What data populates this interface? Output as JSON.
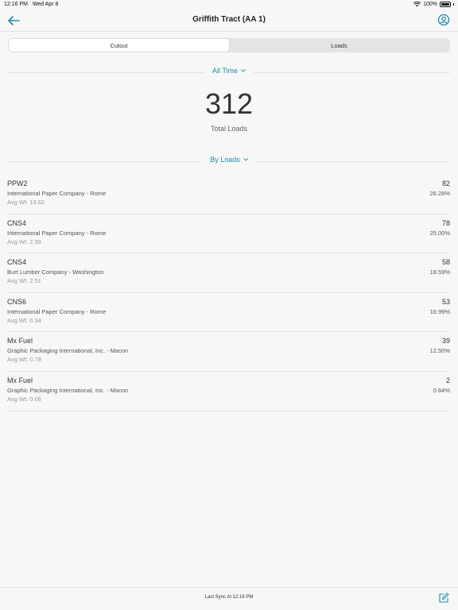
{
  "status_bar": {
    "time": "12:16 PM",
    "date": "Wed Apr 8",
    "battery": "100%",
    "icons": [
      "wifi-icon",
      "battery-icon"
    ]
  },
  "header": {
    "title": "Griffith Tract (AA 1)",
    "back_icon": "arrow-left-icon",
    "profile_icon": "user-circle-icon"
  },
  "tabs": [
    {
      "label": "Cutout",
      "active": true
    },
    {
      "label": "Loads",
      "active": false
    }
  ],
  "time_filter": {
    "label": "All Time",
    "icon": "chevron-down-icon"
  },
  "summary": {
    "value": "312",
    "label": "Total Loads"
  },
  "sort_filter": {
    "label": "By Loads",
    "icon": "chevron-down-icon"
  },
  "rows": [
    {
      "name": "PPW2",
      "company": "International Paper Company - Rome",
      "avg": "Avg Wt: 13.62",
      "count": "82",
      "pct": "26.28%"
    },
    {
      "name": "CNS4",
      "company": "International Paper Company - Rome",
      "avg": "Avg Wt: 2.99",
      "count": "78",
      "pct": "25.00%"
    },
    {
      "name": "CNS4",
      "company": "Burt Lumber Company - Washington",
      "avg": "Avg Wt: 2.51",
      "count": "58",
      "pct": "18.59%"
    },
    {
      "name": "CNS6",
      "company": "International Paper Company - Rome",
      "avg": "Avg Wt: 0.34",
      "count": "53",
      "pct": "16.99%"
    },
    {
      "name": "Mx Fuel",
      "company": "Graphic Packaging International, Inc. - Macon",
      "avg": "Avg Wt: 0.78",
      "count": "39",
      "pct": "12.50%"
    },
    {
      "name": "Mx Fuel",
      "company": "Graphic Packaging International, Inc. - Macon",
      "avg": "Avg Wt: 0.06",
      "count": "2",
      "pct": "0.64%"
    }
  ],
  "footer": {
    "sync_text": "Last Sync At 12:16 PM",
    "compose_icon": "edit-icon"
  },
  "colors": {
    "accent": "#1a8fa8",
    "background": "#f7f7f7",
    "divider": "#e2e2e2"
  }
}
